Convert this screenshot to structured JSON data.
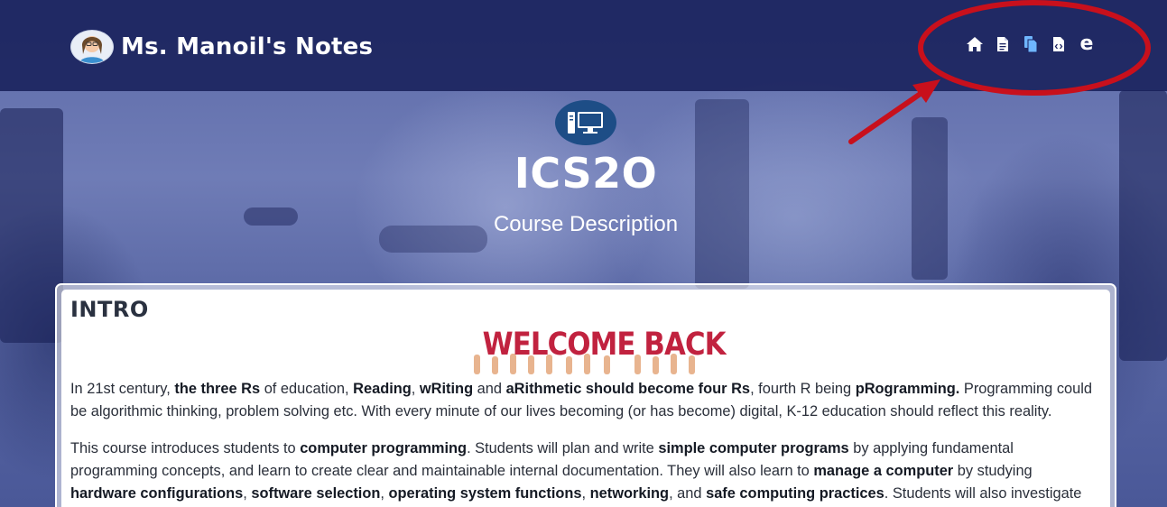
{
  "header": {
    "site_title": "Ms. Manoil's Notes",
    "avatar_icon": "teacher-avatar-icon",
    "nav": [
      {
        "icon": "home-icon",
        "active": false
      },
      {
        "icon": "document-icon",
        "active": false
      },
      {
        "icon": "copy-documents-icon",
        "active": true
      },
      {
        "icon": "code-file-icon",
        "active": false
      },
      {
        "icon": "edge-browser-icon",
        "active": false,
        "glyph": "e"
      }
    ]
  },
  "hero": {
    "icon": "computer-desktop-icon",
    "course_code": "ICS2O",
    "subtitle": "Course Description"
  },
  "intro": {
    "heading": "INTRO",
    "welcome_image_text": "WELCOME BACK",
    "p1": [
      {
        "t": "In 21st century, "
      },
      {
        "t": "the three Rs",
        "b": true
      },
      {
        "t": " of education, "
      },
      {
        "t": "Reading",
        "b": true
      },
      {
        "t": ", "
      },
      {
        "t": "wRiting",
        "b": true
      },
      {
        "t": " and "
      },
      {
        "t": "aRithmetic should become four Rs",
        "b": true
      },
      {
        "t": ", fourth R being "
      },
      {
        "t": "pRogramming.",
        "b": true
      },
      {
        "t": " Programming could be algorithmic thinking, problem solving etc. With every minute of our lives becoming (or has become) digital, K-12 education should reflect this reality."
      }
    ],
    "p2": [
      {
        "t": "This course introduces students to "
      },
      {
        "t": "computer programming",
        "b": true
      },
      {
        "t": ". Students will plan and write "
      },
      {
        "t": "simple computer programs",
        "b": true
      },
      {
        "t": " by applying fundamental programming concepts, and learn to create clear and maintainable internal documentation. They will also learn to "
      },
      {
        "t": "manage a computer",
        "b": true
      },
      {
        "t": " by studying "
      },
      {
        "t": "hardware configurations",
        "b": true
      },
      {
        "t": ", "
      },
      {
        "t": "software selection",
        "b": true
      },
      {
        "t": ", "
      },
      {
        "t": "operating system functions",
        "b": true
      },
      {
        "t": ", "
      },
      {
        "t": "networking",
        "b": true
      },
      {
        "t": ", and "
      },
      {
        "t": "safe computing practices",
        "b": true
      },
      {
        "t": ". Students will also investigate the social impact of computer"
      }
    ]
  },
  "colors": {
    "header_bg": "#161e58",
    "annotation_red": "#c8101c",
    "active_nav": "#6fb6ff",
    "course_icon_bg": "#1d4d86",
    "welcome_red": "#c1223f"
  }
}
